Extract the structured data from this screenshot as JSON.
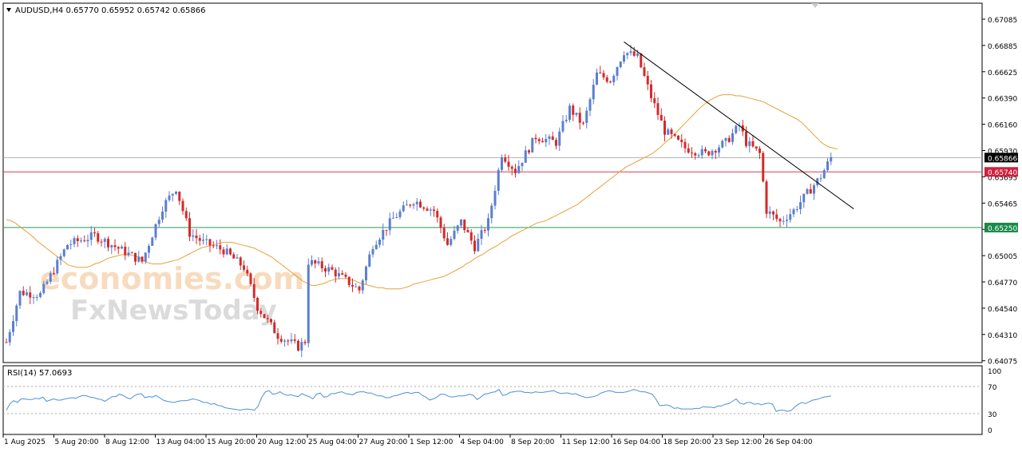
{
  "header": {
    "symbol": "AUDUSD,H4",
    "open": "0.65770",
    "high": "0.65952",
    "low": "0.65742",
    "close": "0.65866"
  },
  "watermark": {
    "line1": "economies.com",
    "line2": "FxNewsToday"
  },
  "rsi": {
    "label": "RSI(14) 57.0693",
    "levels": [
      "100",
      "70",
      "30",
      "0"
    ],
    "values": [
      33,
      44,
      49,
      46,
      52,
      52,
      51,
      51,
      53,
      52,
      55,
      48,
      50,
      52,
      50,
      50,
      52,
      53,
      54,
      53,
      56,
      58,
      57,
      55,
      54,
      52,
      51,
      48,
      52,
      56,
      56,
      60,
      58,
      54,
      52,
      57,
      60,
      61,
      54,
      56,
      55,
      58,
      54,
      50,
      48,
      47,
      46,
      48,
      49,
      49,
      50,
      52,
      51,
      49,
      46,
      46,
      43,
      44,
      41,
      40,
      37,
      36,
      35,
      34,
      33,
      34,
      35,
      34,
      33,
      40,
      55,
      64,
      66,
      60,
      61,
      64,
      60,
      58,
      59,
      57,
      56,
      61,
      58,
      56,
      52,
      60,
      62,
      55,
      56,
      61,
      61,
      63,
      64,
      61,
      60,
      59,
      63,
      64,
      64,
      62,
      62,
      59,
      57,
      57,
      54,
      54,
      57,
      58,
      60,
      62,
      63,
      61,
      63,
      63,
      58,
      55,
      50,
      52,
      55,
      60,
      60,
      57,
      55,
      56,
      57,
      57,
      58,
      60,
      58,
      51,
      55,
      60,
      61,
      63,
      64,
      68,
      58,
      59,
      63,
      64,
      65,
      65,
      63,
      63,
      62,
      64,
      63,
      63,
      64,
      65,
      66,
      63,
      61,
      62,
      62,
      60,
      61,
      58,
      56,
      54,
      55,
      56,
      58,
      62,
      64,
      66,
      65,
      63,
      63,
      63,
      64,
      66,
      68,
      66,
      64,
      64,
      62,
      60,
      52,
      41,
      41,
      42,
      40,
      36,
      37,
      35,
      35,
      35,
      35,
      36,
      36,
      39,
      38,
      38,
      37,
      40,
      40,
      43,
      44,
      48,
      52,
      45,
      43,
      46,
      46,
      43,
      44,
      42,
      44,
      45,
      43,
      31,
      33,
      33,
      31,
      32,
      38,
      43,
      46,
      44,
      47,
      50,
      51,
      53,
      55,
      56,
      57
    ]
  },
  "price_axis": {
    "ticks": [
      "0.67085",
      "0.66885",
      "0.66625",
      "0.66390",
      "0.66160",
      "0.65930",
      "0.65695",
      "0.65465",
      "0.65235",
      "0.65005",
      "0.64770",
      "0.64540",
      "0.64310",
      "0.64075"
    ],
    "ylim": [
      0.64075,
      0.67085
    ],
    "hlines": [
      {
        "label": "0.65866",
        "value": 0.65866,
        "color": "#b0b0b0",
        "badge": "#000000"
      },
      {
        "label": "0.65740",
        "value": 0.6574,
        "color": "#d64050",
        "badge": "#d21f3c"
      },
      {
        "label": "0.65250",
        "value": 0.6525,
        "color": "#2e9a5a",
        "badge": "#1a8a4a"
      }
    ]
  },
  "time_axis": {
    "labels": [
      "1 Aug 2025",
      "5 Aug 20:00",
      "8 Aug 12:00",
      "13 Aug 04:00",
      "15 Aug 20:00",
      "20 Aug 12:00",
      "25 Aug 04:00",
      "27 Aug 20:00",
      "1 Sep 12:00",
      "4 Sep 04:00",
      "8 Sep 20:00",
      "11 Sep 12:00",
      "16 Sep 04:00",
      "18 Sep 20:00",
      "23 Sep 12:00",
      "26 Sep 04:00"
    ]
  },
  "colors": {
    "bull": "#5b7fcf",
    "bear": "#d42a2a",
    "ma": "#e8a03a",
    "rsi": "#4a90d9",
    "trendline": "#000000",
    "grid": "#d8d8d8"
  },
  "chart_data": {
    "type": "candlestick",
    "title": "AUDUSD,H4",
    "moving_average": [
      0.6532,
      0.6531,
      0.6529,
      0.6526,
      0.6523,
      0.652,
      0.6517,
      0.6513,
      0.651,
      0.6507,
      0.6504,
      0.6501,
      0.6498,
      0.6495,
      0.6492,
      0.6491,
      0.649,
      0.649,
      0.649,
      0.6491,
      0.6493,
      0.6494,
      0.6496,
      0.6498,
      0.6499,
      0.65,
      0.6501,
      0.6501,
      0.6501,
      0.65,
      0.6499,
      0.6496,
      0.6494,
      0.6493,
      0.6493,
      0.6493,
      0.6494,
      0.6495,
      0.6496,
      0.6497,
      0.6499,
      0.6501,
      0.6503,
      0.6505,
      0.6507,
      0.6508,
      0.6509,
      0.651,
      0.6511,
      0.6512,
      0.6512,
      0.6512,
      0.6511,
      0.651,
      0.6509,
      0.6508,
      0.6507,
      0.6505,
      0.6503,
      0.6501,
      0.6499,
      0.6496,
      0.6493,
      0.649,
      0.6487,
      0.6484,
      0.6481,
      0.6478,
      0.6476,
      0.6474,
      0.6474,
      0.6475,
      0.6476,
      0.6478,
      0.6479,
      0.648,
      0.648,
      0.648,
      0.6479,
      0.6478,
      0.6476,
      0.6475,
      0.6474,
      0.6473,
      0.6472,
      0.6472,
      0.6471,
      0.6471,
      0.6471,
      0.6471,
      0.6472,
      0.6473,
      0.6475,
      0.6476,
      0.6477,
      0.6478,
      0.6479,
      0.648,
      0.6481,
      0.6482,
      0.6484,
      0.6486,
      0.6488,
      0.649,
      0.6493,
      0.6495,
      0.6498,
      0.65,
      0.6502,
      0.6505,
      0.6507,
      0.6509,
      0.6512,
      0.6514,
      0.6517,
      0.6519,
      0.6521,
      0.6523,
      0.6525,
      0.6527,
      0.6529,
      0.653,
      0.6531,
      0.6533,
      0.6535,
      0.6537,
      0.6539,
      0.6541,
      0.6543,
      0.6545,
      0.6548,
      0.6551,
      0.6554,
      0.6557,
      0.656,
      0.6563,
      0.6566,
      0.6569,
      0.6572,
      0.6575,
      0.6578,
      0.658,
      0.6582,
      0.6584,
      0.6586,
      0.6588,
      0.659,
      0.6593,
      0.6596,
      0.66,
      0.6603,
      0.6607,
      0.6611,
      0.6615,
      0.6619,
      0.6623,
      0.6627,
      0.6631,
      0.6634,
      0.6637,
      0.6639,
      0.6641,
      0.6642,
      0.6642,
      0.6642,
      0.6641,
      0.6641,
      0.664,
      0.6639,
      0.6638,
      0.6637,
      0.6636,
      0.6634,
      0.6632,
      0.663,
      0.6628,
      0.6626,
      0.6624,
      0.6622,
      0.662,
      0.6617,
      0.6613,
      0.6609,
      0.6605,
      0.6601,
      0.6598,
      0.6596,
      0.6595,
      0.6594
    ],
    "trendline": [
      {
        "x_index": 182,
        "y": 0.66885
      },
      {
        "x_index": 245,
        "y": 0.6559
      }
    ],
    "ylim": [
      0.64075,
      0.67085
    ]
  }
}
